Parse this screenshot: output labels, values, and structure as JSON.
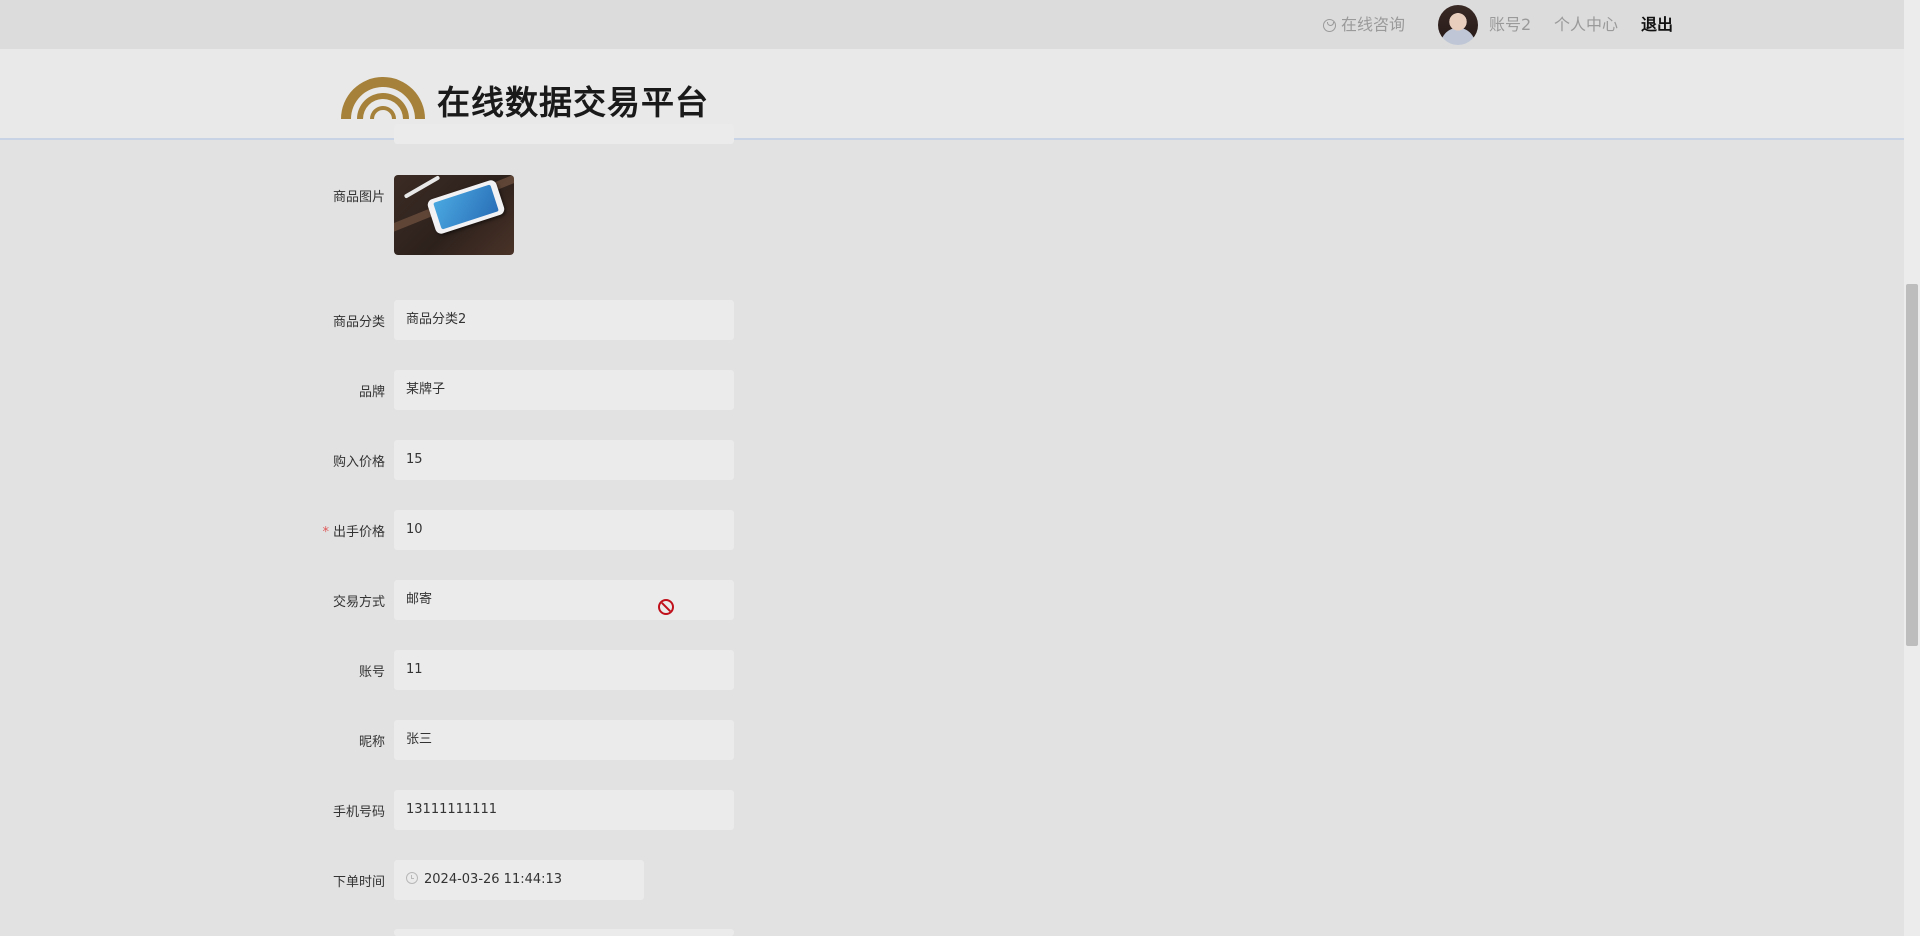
{
  "topbar": {
    "consult": "在线咨询",
    "username": "账号2",
    "profile": "个人中心",
    "logout": "退出"
  },
  "header": {
    "site_title": "在线数据交易平台",
    "logo_color": "#a5813a"
  },
  "form": {
    "image_label": "商品图片",
    "category_label": "商品分类",
    "category_value": "商品分类2",
    "brand_label": "品牌",
    "brand_value": "某牌子",
    "purchase_price_label": "购入价格",
    "purchase_price_value": "15",
    "sell_price_required": "*",
    "sell_price_label": "出手价格",
    "sell_price_value": "10",
    "trade_method_label": "交易方式",
    "trade_method_value": "邮寄",
    "account_label": "账号",
    "account_value": "11",
    "nickname_label": "昵称",
    "nickname_value": "张三",
    "phone_label": "手机号码",
    "phone_value": "13111111111",
    "order_time_label": "下单时间",
    "order_time_value": "2024-03-26 11:44:13"
  },
  "icons": [
    "user-circle-icon",
    "clock-icon",
    "not-allowed-icon"
  ]
}
